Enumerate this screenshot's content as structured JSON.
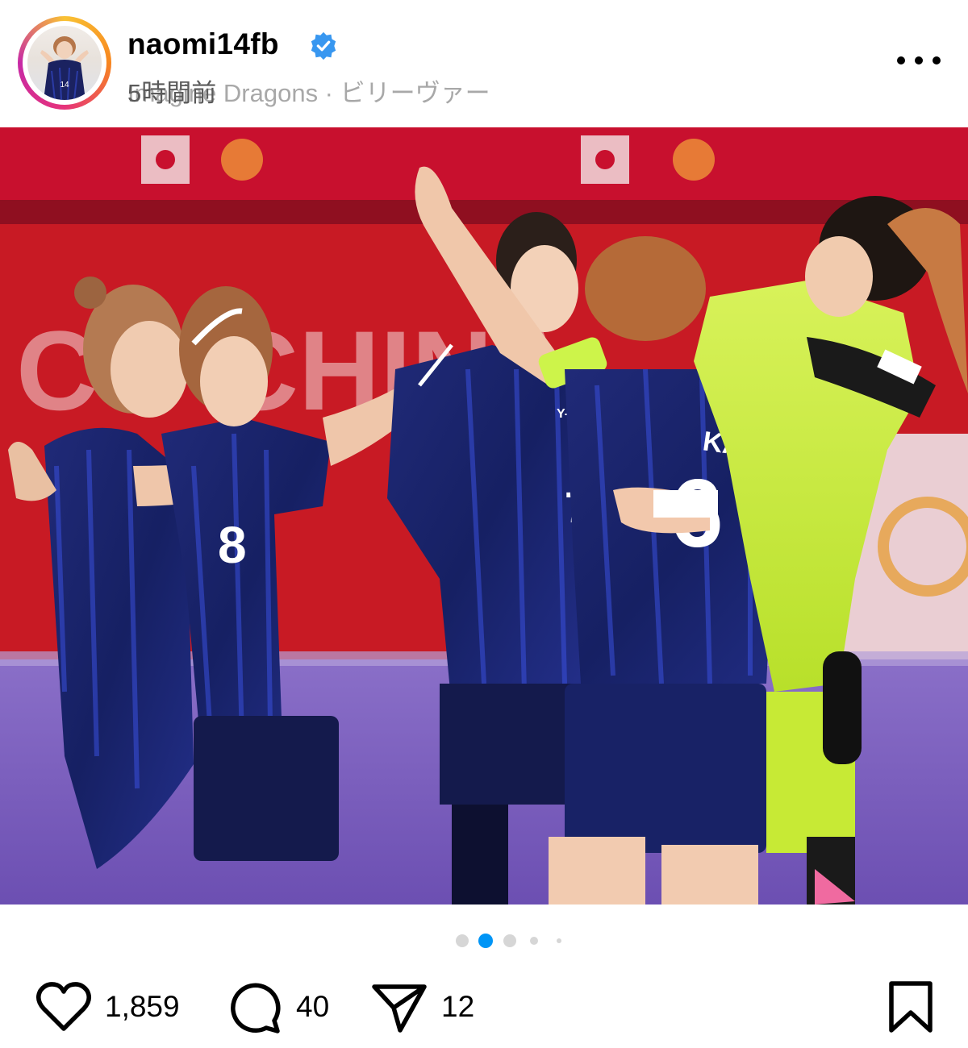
{
  "post": {
    "username": "naomi14fb",
    "verified": true,
    "time": "5時間前",
    "music": "Imagine Dragons · ビリーヴァー",
    "avatar_jersey_number": "14",
    "photo": {
      "jersey_numbers": [
        "8",
        "7",
        "6"
      ],
      "back_name": "KAHO",
      "brand": "Y-3"
    },
    "carousel": {
      "current": 2,
      "total": 5
    },
    "likes": "1,859",
    "comments": "40",
    "shares": "12",
    "sound": "muted"
  },
  "icons": {
    "verified": "verified-badge-icon",
    "more": "more-options-icon",
    "like": "heart-icon",
    "comment": "comment-bubble-icon",
    "share": "paper-plane-icon",
    "save": "bookmark-icon",
    "mute": "speaker-muted-icon"
  },
  "colors": {
    "verified_blue": "#3897f0",
    "active_dot": "#0095f6",
    "inactive_dot": "#d6d6d6",
    "meta_text": "#8e8e8e",
    "jersey_navy": "#1b2260",
    "goalkeeper_yellow": "#c9ee3a",
    "board_red": "#c8102e"
  }
}
